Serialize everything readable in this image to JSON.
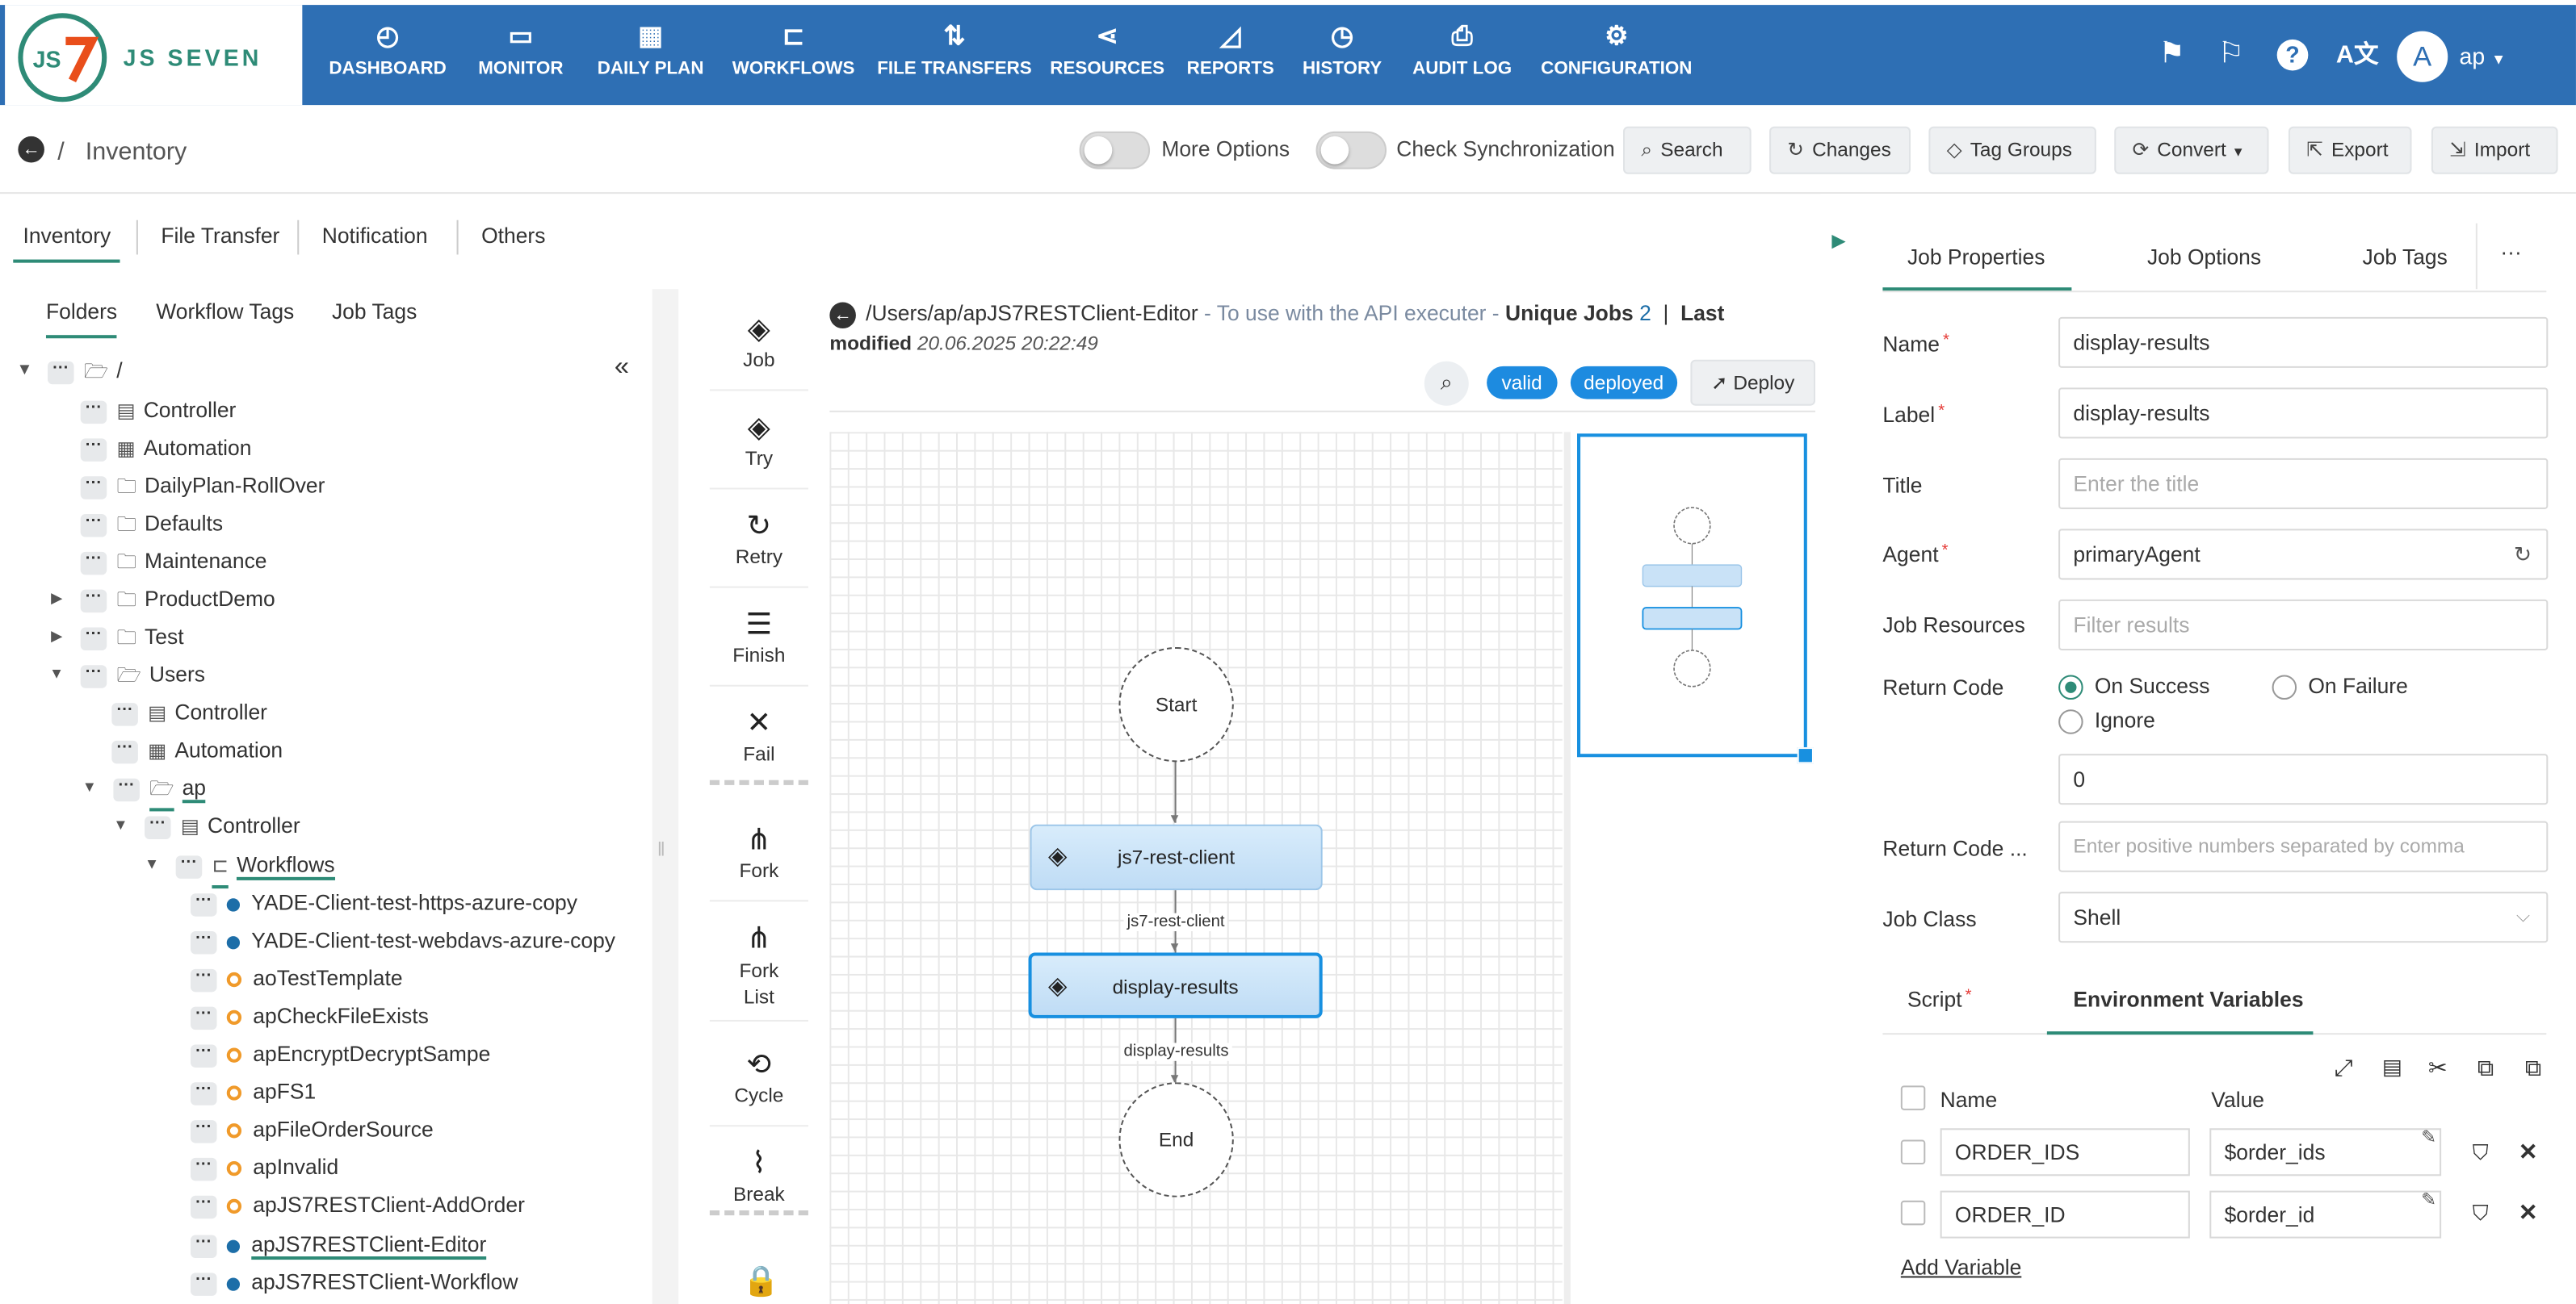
{
  "app": {
    "logo_text": "JS SEVEN",
    "logo_mark": "JS7"
  },
  "nav": {
    "items": [
      {
        "label": "DASHBOARD",
        "icon": "dashboard-icon"
      },
      {
        "label": "MONITOR",
        "icon": "monitor-icon"
      },
      {
        "label": "DAILY PLAN",
        "icon": "calendar-icon"
      },
      {
        "label": "WORKFLOWS",
        "icon": "workflow-icon"
      },
      {
        "label": "FILE TRANSFERS",
        "icon": "transfer-icon"
      },
      {
        "label": "RESOURCES",
        "icon": "share-icon"
      },
      {
        "label": "REPORTS",
        "icon": "chart-icon"
      },
      {
        "label": "HISTORY",
        "icon": "clock-icon"
      },
      {
        "label": "AUDIT LOG",
        "icon": "audit-icon"
      },
      {
        "label": "CONFIGURATION",
        "icon": "gear-icon"
      }
    ],
    "user_initial": "A",
    "user_name": "ap",
    "accent": "#2e6fb4"
  },
  "subheader": {
    "breadcrumb": "Inventory",
    "more_options": "More Options",
    "check_sync": "Check Synchronization",
    "buttons": {
      "search": "Search",
      "changes": "Changes",
      "tag_groups": "Tag Groups",
      "convert": "Convert",
      "export": "Export",
      "import": "Import"
    }
  },
  "left": {
    "tabs": [
      "Inventory",
      "File Transfer",
      "Notification",
      "Others"
    ],
    "subtabs": [
      "Folders",
      "Workflow Tags",
      "Job Tags"
    ],
    "tree": {
      "root": "/",
      "top": [
        "Controller",
        "Automation",
        "DailyPlan-RollOver",
        "Defaults",
        "Maintenance",
        "ProductDemo",
        "Test",
        "Users"
      ],
      "users": [
        "Controller",
        "Automation"
      ],
      "ap": "ap",
      "ap_controller": "Controller",
      "workflows": "Workflows",
      "items": [
        "YADE-Client-test-https-azure-copy",
        "YADE-Client-test-webdavs-azure-copy",
        "aoTestTemplate",
        "apCheckFileExists",
        "apEncryptDecryptSampe",
        "apFS1",
        "apFileOrderSource",
        "apInvalid",
        "apJS7RESTClient-AddOrder",
        "apJS7RESTClient-Editor",
        "apJS7RESTClient-Workflow"
      ]
    }
  },
  "palette": {
    "items": [
      "Job",
      "Try",
      "Retry",
      "Finish",
      "Fail",
      "Fork",
      "Fork List",
      "Cycle",
      "Break"
    ]
  },
  "workflow": {
    "path": "/Users/ap/apJS7RESTClient-Editor",
    "description": " - To use with the API executer - ",
    "unique_jobs_label": "Unique Jobs",
    "unique_jobs": "2",
    "last_modified_label": "Last modified",
    "last_modified": "20.06.2025 20:22:49",
    "badge_valid": "valid",
    "badge_deployed": "deployed",
    "deploy": "Deploy",
    "nodes": {
      "start": "Start",
      "end": "End"
    },
    "jobs": [
      "js7-rest-client",
      "display-results"
    ]
  },
  "job": {
    "tabs": [
      "Job Properties",
      "Job Options",
      "Job Tags"
    ],
    "more": "···",
    "labels": {
      "name": "Name",
      "label": "Label",
      "title": "Title",
      "agent": "Agent",
      "job_resources": "Job Resources",
      "return_code": "Return Code",
      "return_code_warn": "Return Code ...",
      "job_class": "Job Class"
    },
    "values": {
      "name": "display-results",
      "label": "display-results",
      "title_placeholder": "Enter the title",
      "agent": "primaryAgent",
      "resources_placeholder": "Filter results",
      "rc_value": "0",
      "rc_warn_placeholder": "Enter positive numbers separated by comma",
      "job_class": "Shell"
    },
    "return_code_options": [
      "On Success",
      "On Failure",
      "Ignore"
    ],
    "bottom_tabs": [
      "Script",
      "Environment Variables"
    ],
    "env_headers": {
      "name": "Name",
      "value": "Value"
    },
    "env": [
      {
        "name": "ORDER_IDS",
        "value": "$order_ids"
      },
      {
        "name": "ORDER_ID",
        "value": "$order_id"
      }
    ],
    "add_variable": "Add Variable"
  }
}
